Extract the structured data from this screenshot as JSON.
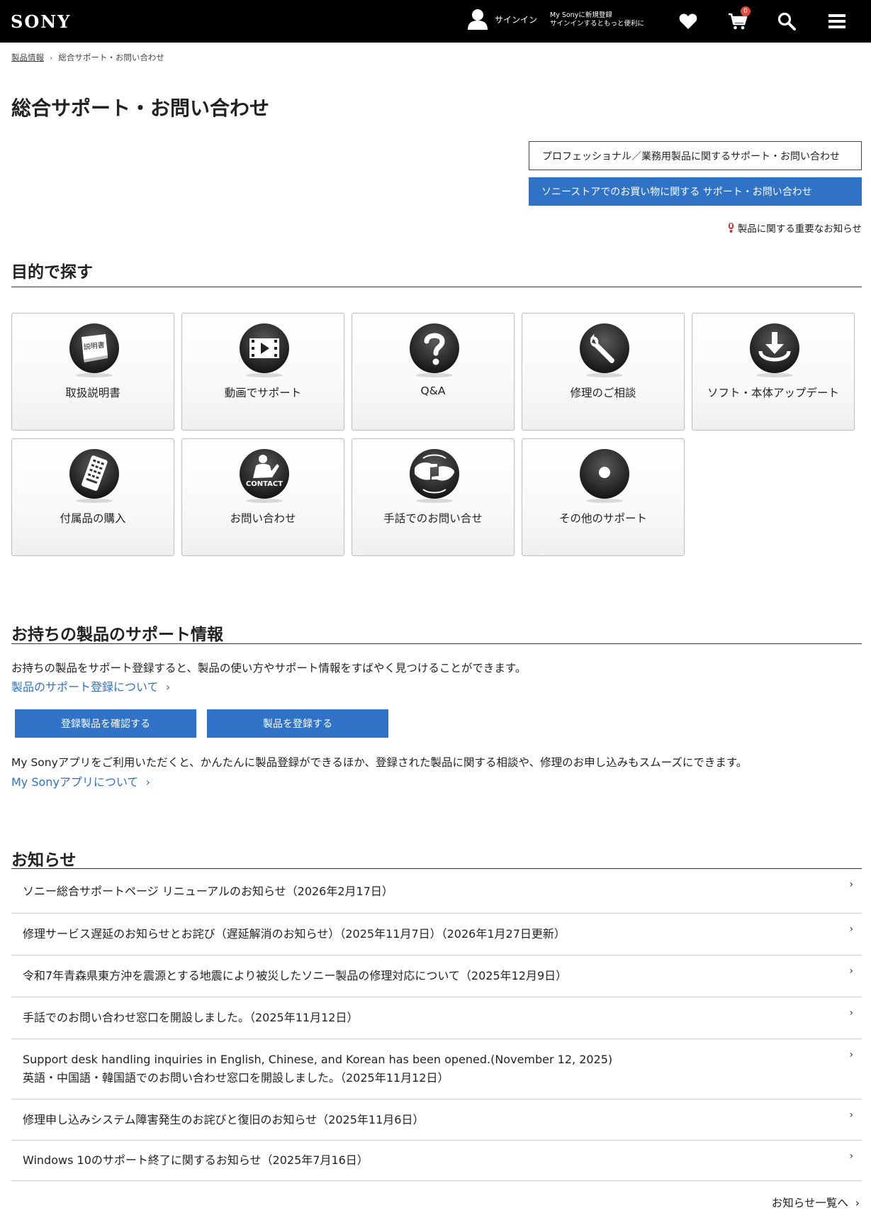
{
  "header": {
    "logo": "SONY",
    "signin_label": "サインイン",
    "signin_promo_line1": "My Sonyに新規登録",
    "signin_promo_line2": "サインインするともっと便利に",
    "cart_count": "0",
    "icons": [
      "user-icon",
      "heart-icon",
      "cart-icon",
      "search-icon",
      "menu-icon"
    ]
  },
  "breadcrumb": {
    "home": "製品情報",
    "current": "総合サポート・お問い合わせ"
  },
  "page_title": "総合サポート・お問い合わせ",
  "top_links": {
    "professional": "プロフェッショナル／業務用製品に関するサポート・お問い合わせ",
    "store": "ソニーストアでのお買い物に関する サポート・お問い合わせ",
    "important_notice": "製品に関する重要なお知らせ"
  },
  "purpose": {
    "title": "目的で探す",
    "tiles": [
      {
        "label": "取扱説明書",
        "icon": "manual-icon",
        "icon_text": "説明書"
      },
      {
        "label": "動画でサポート",
        "icon": "video-icon"
      },
      {
        "label": "Q&A",
        "icon": "question-icon"
      },
      {
        "label": "修理のご相談",
        "icon": "wrench-icon"
      },
      {
        "label": "ソフト・本体アップデート",
        "icon": "download-icon"
      },
      {
        "label": "付属品の購入",
        "icon": "accessory-icon"
      },
      {
        "label": "お問い合わせ",
        "icon": "contact-icon",
        "icon_text": "CONTACT"
      },
      {
        "label": "手話でのお問い合せ",
        "icon": "sign-language-icon"
      },
      {
        "label": "その他のサポート",
        "icon": "other-support-icon"
      }
    ]
  },
  "my_products": {
    "title": "お持ちの製品のサポート情報",
    "description": "お持ちの製品をサポート登録すると、製品の使い方やサポート情報をすばやく見つけることができます。",
    "register_info_link": "製品のサポート登録について",
    "btn_check": "登録製品を確認する",
    "btn_register": "製品を登録する",
    "app_description": "My Sonyアプリをご利用いただくと、かんたんに製品登録ができるほか、登録された製品に関する相談や、修理のお申し込みもスムーズにできます。",
    "app_link": "My Sonyアプリについて"
  },
  "news": {
    "title": "お知らせ",
    "items": [
      {
        "line1": "ソニー総合サポートページ リニューアルのお知らせ（2026年2月17日）"
      },
      {
        "line1": "修理サービス遅延のお知らせとお詫び（遅延解消のお知らせ）（2025年11月7日）（2026年1月27日更新）"
      },
      {
        "line1": "令和7年青森県東方沖を震源とする地震により被災したソニー製品の修理対応について（2025年12月9日）"
      },
      {
        "line1": "手話でのお問い合わせ窓口を開設しました。（2025年11月12日）"
      },
      {
        "line1": "Support desk handling inquiries in English, Chinese, and Korean has been opened.(November 12, 2025)",
        "line2": "英語・中国語・韓国語でのお問い合わせ窓口を開設しました。（2025年11月12日）"
      },
      {
        "line1": "修理申し込みシステム障害発生のお詫びと復旧のお知らせ（2025年11月6日）"
      },
      {
        "line1": "Windows 10のサポート終了に関するお知らせ（2025年7月16日）"
      }
    ],
    "all_link": "お知らせ一覧へ"
  },
  "colors": {
    "accent": "#2f72c6",
    "header_bg": "#000000",
    "badge": "#e2483a"
  }
}
